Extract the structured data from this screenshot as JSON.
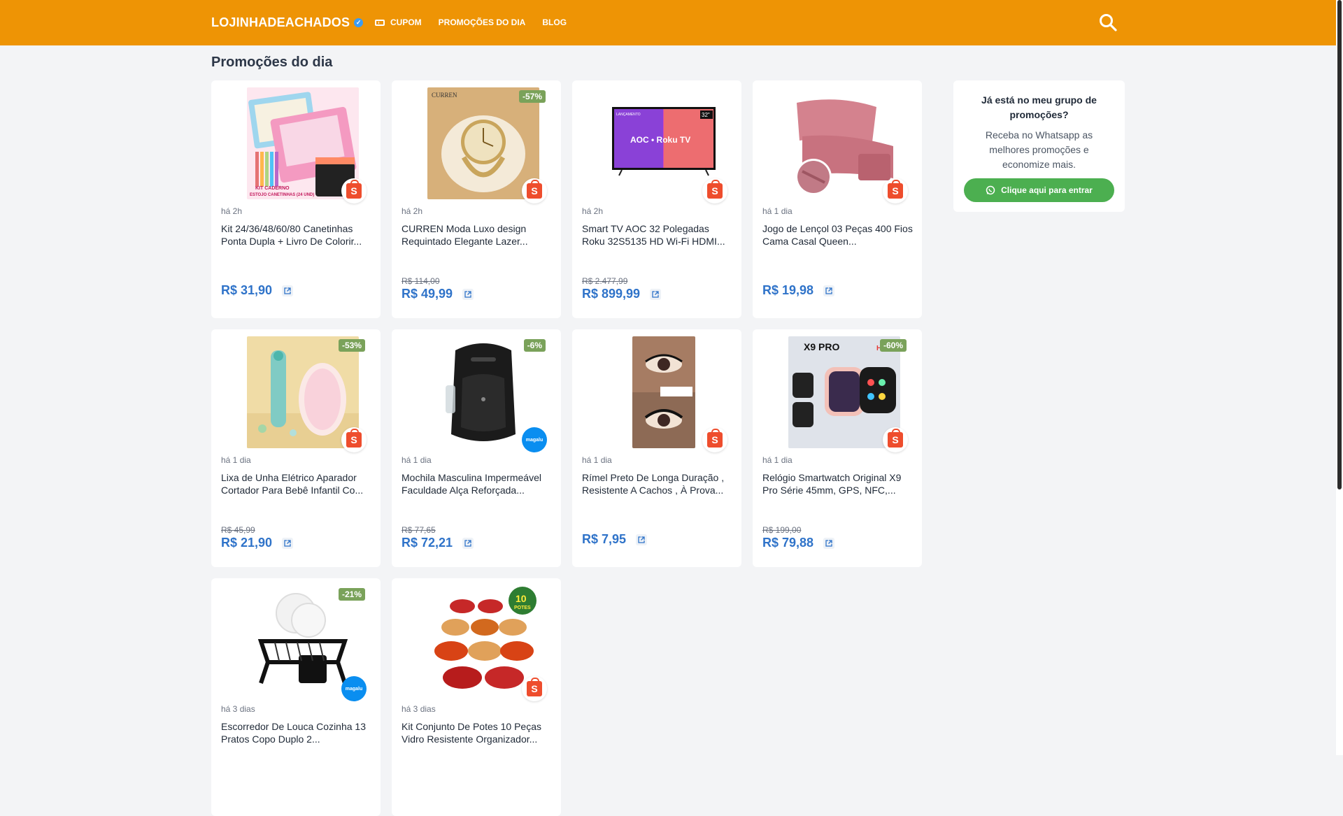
{
  "header": {
    "brand": "LOJINHADEACHADOS",
    "nav": [
      {
        "label": "CUPOM"
      },
      {
        "label": "PROMOÇÕES DO DIA"
      },
      {
        "label": "BLOG"
      }
    ],
    "bg_color": "#ee9405"
  },
  "page": {
    "title": "Promoções do dia"
  },
  "products": [
    {
      "time": "há 2h",
      "title": "Kit 24/36/48/60/80 Canetinhas Ponta Dupla + Livro De Colorir...",
      "old_price": "",
      "price": "R$ 31,90",
      "discount": "",
      "store": "shopee"
    },
    {
      "time": "há 2h",
      "title": "CURREN Moda Luxo design Requintado Elegante Lazer...",
      "old_price": "R$ 114,00",
      "price": "R$ 49,99",
      "discount": "-57%",
      "store": "shopee"
    },
    {
      "time": "há 2h",
      "title": "Smart TV AOC 32 Polegadas Roku 32S5135 HD Wi-Fi HDMI...",
      "old_price": "R$ 2.477,99",
      "price": "R$ 899,99",
      "discount": "",
      "store": "shopee"
    },
    {
      "time": "há 1 dia",
      "title": "Jogo de Lençol 03 Peças 400 Fios Cama Casal Queen...",
      "old_price": "",
      "price": "R$ 19,98",
      "discount": "",
      "store": "shopee"
    },
    {
      "time": "há 1 dia",
      "title": "Lixa de Unha Elétrico Aparador Cortador Para Bebê Infantil Co...",
      "old_price": "R$ 45,99",
      "price": "R$ 21,90",
      "discount": "-53%",
      "store": "shopee"
    },
    {
      "time": "há 1 dia",
      "title": "Mochila Masculina Impermeável Faculdade Alça Reforçada...",
      "old_price": "R$ 77,65",
      "price": "R$ 72,21",
      "discount": "-6%",
      "store": "magalu"
    },
    {
      "time": "há 1 dia",
      "title": "Rímel Preto De Longa Duração , Resistente A Cachos , À Prova...",
      "old_price": "",
      "price": "R$ 7,95",
      "discount": "",
      "store": "shopee"
    },
    {
      "time": "há 1 dia",
      "title": "Relógio Smartwatch Original X9 Pro Série 45mm, GPS, NFC,...",
      "old_price": "R$ 199,00",
      "price": "R$ 79,88",
      "discount": "-60%",
      "store": "shopee"
    },
    {
      "time": "há 3 dias",
      "title": "Escorredor De Louca Cozinha 13 Pratos Copo Duplo 2...",
      "old_price": "",
      "price": "",
      "discount": "-21%",
      "store": "magalu"
    },
    {
      "time": "há 3 dias",
      "title": "Kit Conjunto De Potes 10 Peças Vidro Resistente Organizador...",
      "old_price": "",
      "price": "",
      "discount": "",
      "store": "shopee"
    }
  ],
  "image_text": {
    "kit_caderno": "KIT CADERNO",
    "estojo": "ESTOJO CANETINHAS (24 UND)",
    "curren": "CURREN",
    "tv_logo": "AOC • Roku TV",
    "tv_size": "32\"",
    "tv_launch": "LANÇAMENTO",
    "x9": "X9 PRO",
    "hot": "HOT",
    "potes_num": "10",
    "potes": "POTES",
    "magalu": "magalu"
  },
  "sidebar": {
    "title": "Já está no meu grupo de promoções?",
    "text": "Receba no Whatsapp as melhores promoções e economize mais.",
    "button": "Clique aqui para entrar"
  },
  "colors": {
    "price": "#2f73c9",
    "whatsapp_button": "#4caf50",
    "discount_badge": "#7aa25a",
    "shopee": "#ee4d2d",
    "magalu": "#0a8ef0"
  }
}
